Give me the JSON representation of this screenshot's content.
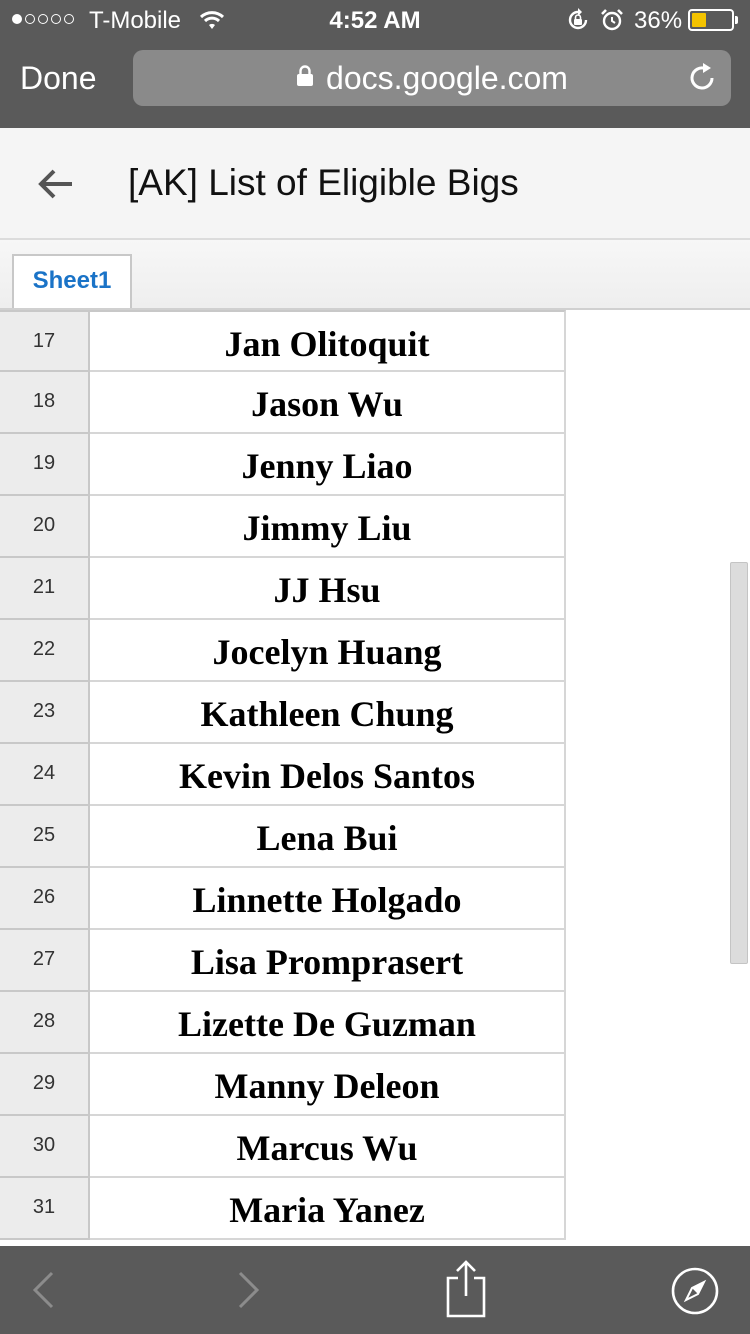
{
  "status_bar": {
    "carrier": "T-Mobile",
    "time": "4:52 AM",
    "battery_percent": "36%",
    "battery_level": 0.36,
    "signal_bars": 1,
    "signal_bars_total": 5,
    "icons": [
      "signal-dots",
      "wifi-icon",
      "rotation-lock-icon",
      "alarm-icon",
      "battery-icon"
    ]
  },
  "nav": {
    "done_label": "Done",
    "url": "docs.google.com",
    "icons": [
      "lock-icon",
      "reload-icon"
    ]
  },
  "doc": {
    "title": "[AK] List of Eligible Bigs",
    "back_icon": "back-arrow-icon"
  },
  "tabs": [
    {
      "label": "Sheet1",
      "active": true
    }
  ],
  "rows": [
    {
      "num": "17",
      "name": "Jan Olitoquit"
    },
    {
      "num": "18",
      "name": "Jason Wu"
    },
    {
      "num": "19",
      "name": "Jenny Liao"
    },
    {
      "num": "20",
      "name": "Jimmy Liu"
    },
    {
      "num": "21",
      "name": "JJ Hsu"
    },
    {
      "num": "22",
      "name": "Jocelyn Huang"
    },
    {
      "num": "23",
      "name": "Kathleen Chung"
    },
    {
      "num": "24",
      "name": "Kevin Delos Santos"
    },
    {
      "num": "25",
      "name": "Lena Bui"
    },
    {
      "num": "26",
      "name": "Linnette Holgado"
    },
    {
      "num": "27",
      "name": "Lisa Promprasert"
    },
    {
      "num": "28",
      "name": "Lizette De Guzman"
    },
    {
      "num": "29",
      "name": "Manny Deleon"
    },
    {
      "num": "30",
      "name": "Marcus Wu"
    },
    {
      "num": "31",
      "name": "Maria Yanez"
    }
  ],
  "toolbar": {
    "icons": [
      "back-chevron-icon",
      "forward-chevron-icon",
      "share-icon",
      "safari-compass-icon"
    ]
  },
  "colors": {
    "chrome": "#5a5a5a",
    "address_bar": "#8a8a8a",
    "tab_text": "#1a73c7",
    "battery_fill": "#f5c400"
  }
}
